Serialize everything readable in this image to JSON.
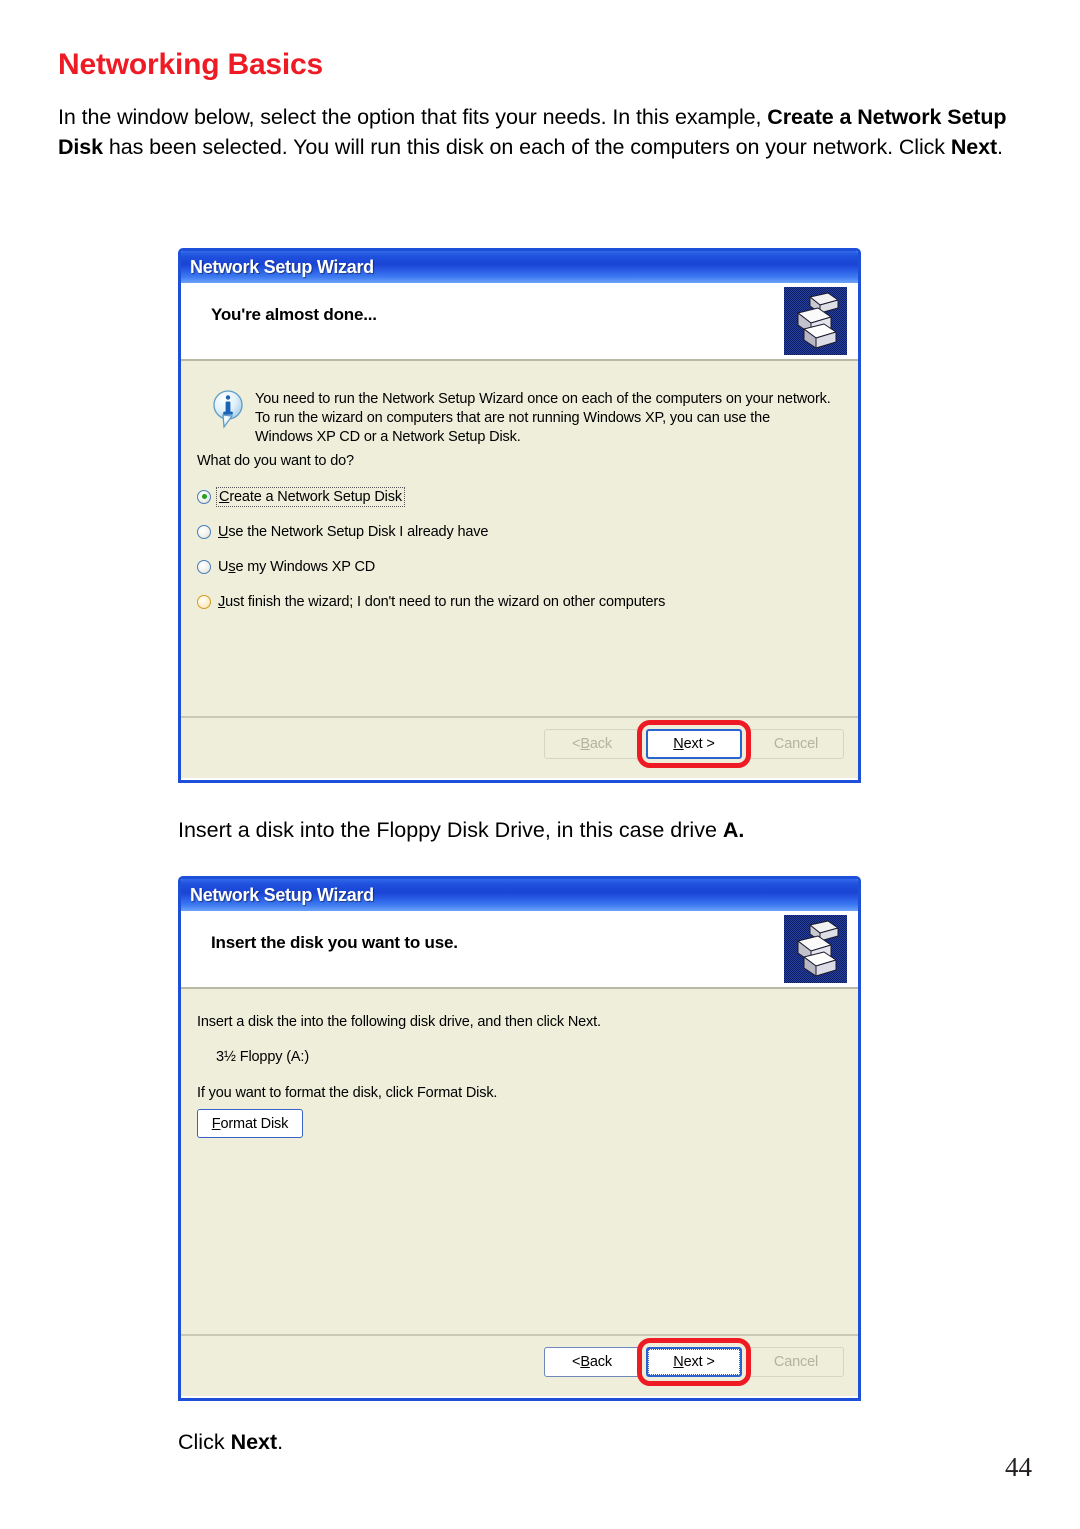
{
  "page": {
    "title": "Networking Basics",
    "title_color": "#ee1b24",
    "page_number": "44"
  },
  "intro_paragraph": {
    "part1": "In the window below, select the option that fits your needs. In this example, ",
    "bold1": "Create a Network Setup Disk",
    "part2": " has been selected.  You will run this disk on each of the computers on your network. Click ",
    "bold2": "Next",
    "part3": "."
  },
  "middle_paragraph": {
    "part1": "Insert a disk into the Floppy Disk Drive, in this case drive ",
    "bold1": "A.",
    "part2": ""
  },
  "bottom_paragraph": {
    "part1": "Click ",
    "bold1": "Next",
    "part2": "."
  },
  "dialog1": {
    "titlebar": "Network Setup Wizard",
    "header_title": "You're almost done...",
    "header_icon": "network-setup-wizard-icon",
    "info_icon": "information-balloon-icon",
    "info_text": "You need to run the Network Setup Wizard once on each of the computers on your network. To run the wizard on computers that are not running Windows XP, you can use the Windows XP CD or a Network Setup Disk.",
    "question": "What do you want to do?",
    "radio_options": [
      {
        "label": "Create a Network Setup Disk",
        "accesskey": "C",
        "selected": true,
        "focused": true,
        "style": "blue"
      },
      {
        "label": "Use the Network Setup Disk I already have",
        "accesskey": "U",
        "selected": false,
        "focused": false,
        "style": "blue"
      },
      {
        "label": "Use my Windows XP CD",
        "accesskey": "s",
        "selected": false,
        "focused": false,
        "style": "blue"
      },
      {
        "label": "Just finish the wizard; I don't need to run the wizard on other computers",
        "accesskey": "J",
        "selected": false,
        "focused": false,
        "style": "amber"
      }
    ],
    "buttons": {
      "back": {
        "label": "< Back",
        "state": "disabled"
      },
      "next": {
        "label": "Next >",
        "state": "default",
        "highlighted": true
      },
      "cancel": {
        "label": "Cancel",
        "state": "disabled"
      }
    }
  },
  "dialog2": {
    "titlebar": "Network Setup Wizard",
    "header_title": "Insert the disk you want to use.",
    "header_icon": "network-setup-wizard-icon",
    "instruction": "Insert a disk the into the following disk drive, and then click Next.",
    "drive": "3½ Floppy (A:)",
    "format_instruction": "If you want to format the disk, click Format Disk.",
    "format_button": "Format Disk",
    "buttons": {
      "back": {
        "label": "< Back",
        "state": "enabled"
      },
      "next": {
        "label": "Next >",
        "state": "default",
        "highlighted": true
      },
      "cancel": {
        "label": "Cancel",
        "state": "disabled"
      }
    }
  },
  "colors": {
    "accent_red": "#ee1b24",
    "titlebar_blue": "#1f4fdd",
    "dialog_border": "#1e4fd8",
    "content_bg": "#eeeedb",
    "highlight_ring": "#ee1b24"
  }
}
